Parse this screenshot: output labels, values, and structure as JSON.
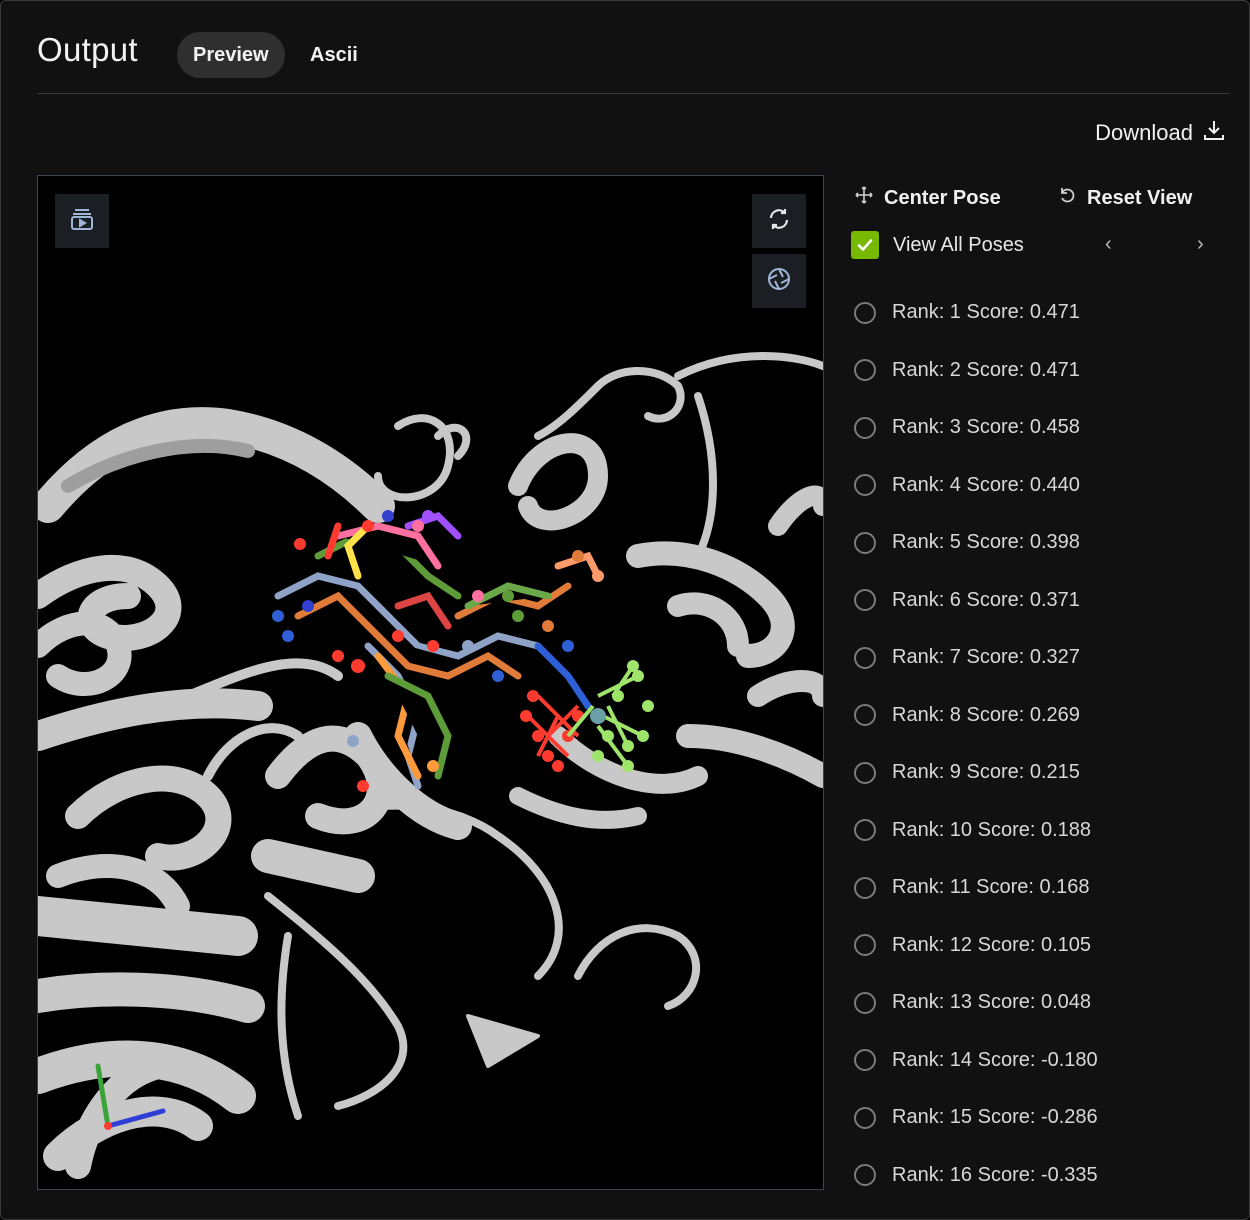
{
  "header": {
    "title": "Output",
    "tabs": [
      {
        "label": "Preview",
        "active": true
      },
      {
        "label": "Ascii",
        "active": false
      }
    ]
  },
  "toolbar": {
    "download_label": "Download"
  },
  "viewer": {
    "top_left_icon": "media-layers-icon",
    "top_right_icons": [
      "sync-rotate-icon",
      "aperture-camera-icon"
    ],
    "axes_icon": "xyz-axes-icon"
  },
  "controls": {
    "center_pose_label": "Center Pose",
    "reset_view_label": "Reset View",
    "view_all_poses_label": "View All Poses",
    "view_all_poses_checked": true,
    "prev_icon": "chevron-left-icon",
    "next_icon": "chevron-right-icon"
  },
  "poses": [
    {
      "label": "Rank: 1 Score: 0.471"
    },
    {
      "label": "Rank: 2 Score: 0.471"
    },
    {
      "label": "Rank: 3 Score: 0.458"
    },
    {
      "label": "Rank: 4 Score: 0.440"
    },
    {
      "label": "Rank: 5 Score: 0.398"
    },
    {
      "label": "Rank: 6 Score: 0.371"
    },
    {
      "label": "Rank: 7 Score: 0.327"
    },
    {
      "label": "Rank: 8 Score: 0.269"
    },
    {
      "label": "Rank: 9 Score: 0.215"
    },
    {
      "label": "Rank: 10 Score: 0.188"
    },
    {
      "label": "Rank: 11 Score: 0.168"
    },
    {
      "label": "Rank: 12 Score: 0.105"
    },
    {
      "label": "Rank: 13 Score: 0.048"
    },
    {
      "label": "Rank: 14 Score: -0.180"
    },
    {
      "label": "Rank: 15 Score: -0.286"
    },
    {
      "label": "Rank: 16 Score: -0.335"
    }
  ],
  "colors": {
    "accent": "#76b900",
    "background": "#111111",
    "ribbon": "#c8c8c8"
  }
}
